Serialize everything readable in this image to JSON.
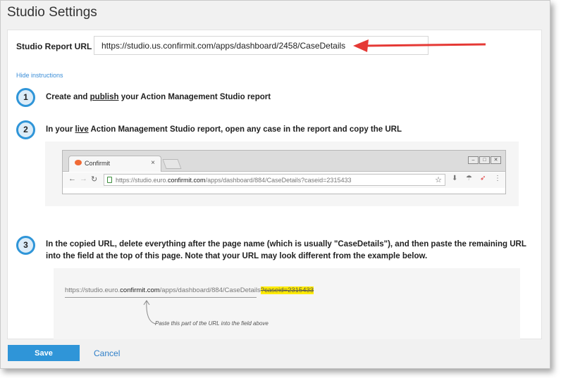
{
  "title": "Studio Settings",
  "url_field": {
    "label": "Studio Report URL",
    "value": "https://studio.us.confirmit.com/apps/dashboard/2458/CaseDetails"
  },
  "hide_instructions": "Hide instructions",
  "steps": [
    {
      "number": "1",
      "pre": "Create and ",
      "link": "publish",
      "post": " your Action Management Studio report"
    },
    {
      "number": "2",
      "pre": "In your ",
      "link": "live",
      "post": " Action Management Studio report, open any case in the report and copy the URL"
    },
    {
      "number": "3",
      "text": "In the copied URL, delete everything after the page name (which is usually \"CaseDetails\"), and then paste the remaining URL into the field at the top of this page. Note that your URL may look different from the example below."
    }
  ],
  "browser_mockup": {
    "tab_title": "Confirmit",
    "tab_close": "×",
    "url_prefix": "https://studio.euro.",
    "url_host": "confirmit.com",
    "url_path": "/apps/dashboard/884/CaseDetails?caseid=2315433"
  },
  "url_example": {
    "prefix": "https://studio.euro.",
    "host": "confirmit.com",
    "path": "/apps/dashboard/884/CaseDetails",
    "removed": "?caseid=2315433",
    "callout": "Paste this part of the URL into the field above"
  },
  "footer": {
    "save_label": "Save",
    "cancel_label": "Cancel"
  },
  "colors": {
    "accent": "#2f95d8",
    "arrow": "#e53935",
    "highlight": "#ffeb00"
  }
}
